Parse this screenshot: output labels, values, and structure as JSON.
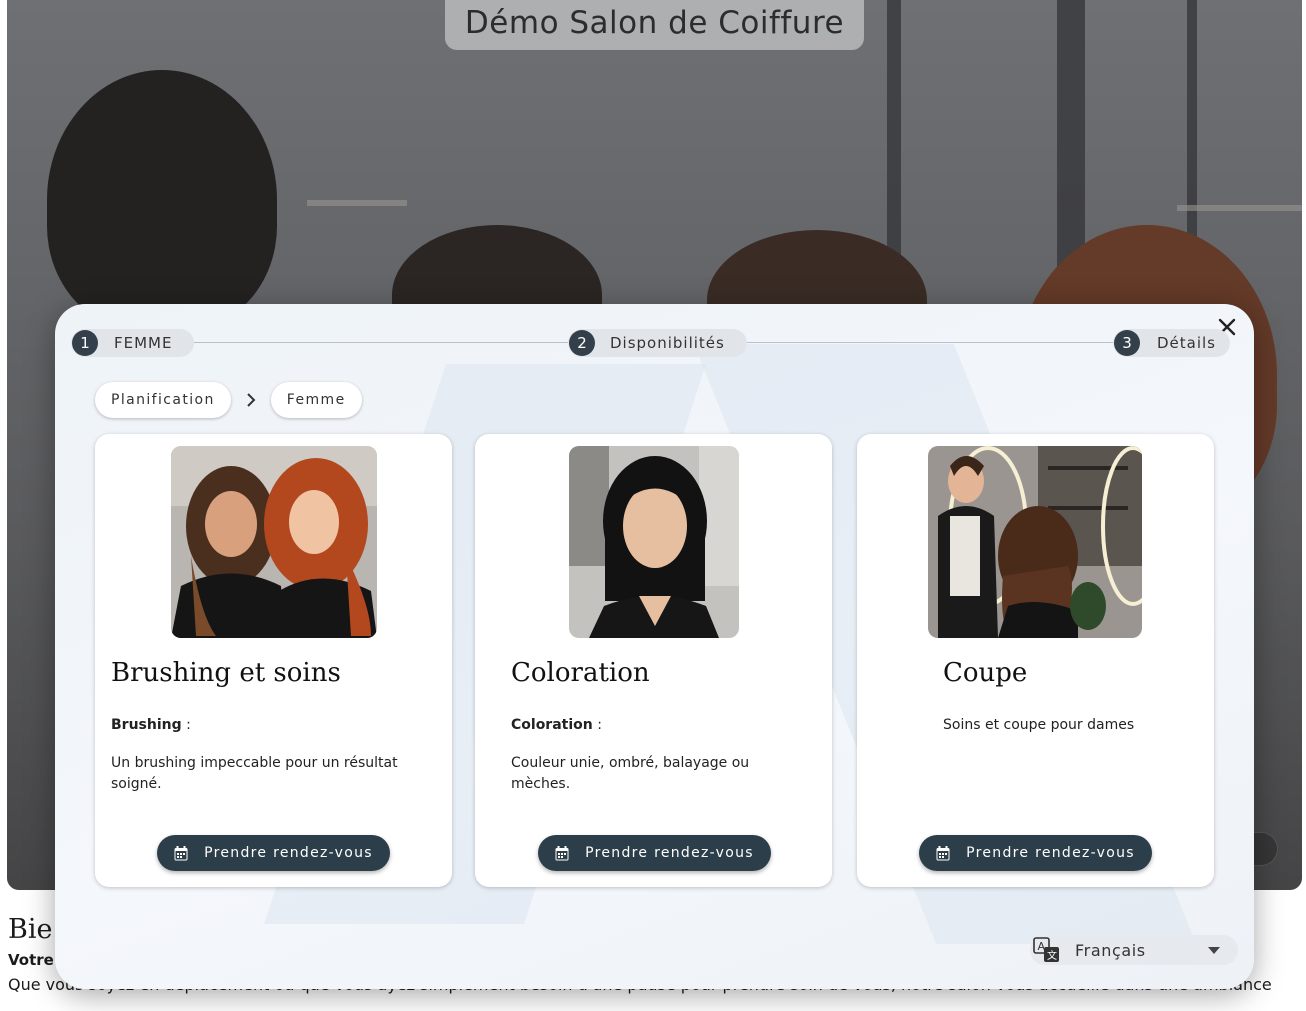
{
  "site": {
    "title": "Démo Salon de Coiffure",
    "welcome": "Bie",
    "subhead": "Votre",
    "intro": "Que vous soyez en déplacement ou que vous ayez simplement besoin d'une pause pour prendre soin de vous, notre salon vous accueille dans une ambiance"
  },
  "stepper": {
    "steps": [
      {
        "number": "1",
        "label": "FEMME"
      },
      {
        "number": "2",
        "label": "Disponibilités"
      },
      {
        "number": "3",
        "label": "Détails"
      }
    ]
  },
  "breadcrumb": {
    "items": [
      "Planification",
      "Femme"
    ]
  },
  "services": [
    {
      "title": "Brushing et soins",
      "tag_bold": "Brushing",
      "tag_suffix": " :",
      "description": "Un brushing impeccable pour un résultat soigné.",
      "button": "Prendre rendez-vous"
    },
    {
      "title": "Coloration",
      "tag_bold": "Coloration",
      "tag_suffix": " :",
      "description": "Couleur unie, ombré, balayage ou mèches.",
      "button": "Prendre rendez-vous"
    },
    {
      "title": "Coupe",
      "tag_text": "Soins et coupe pour dames",
      "button": "Prendre rendez-vous"
    }
  ],
  "language": {
    "selected": "Français"
  },
  "icons": {
    "close": "close-icon",
    "chevron": "chevron-right-icon",
    "calendar": "calendar-icon",
    "translate": "translate-icon",
    "dropdown": "caret-down-icon"
  },
  "colors": {
    "primary": "#2c3e4a",
    "step_circle": "#33404b",
    "modal_bg": "#f1f5f9"
  }
}
